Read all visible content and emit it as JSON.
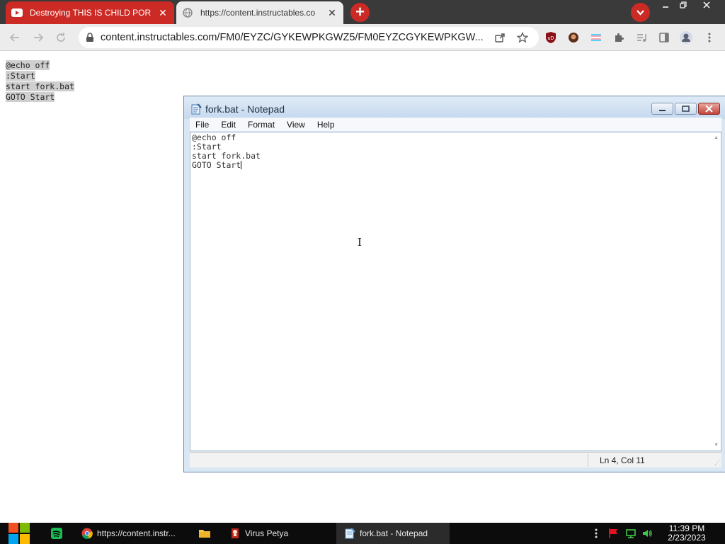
{
  "browser": {
    "tabs": [
      {
        "title": "Destroying THIS IS CHILD POR",
        "favicon": "youtube-icon",
        "active": false
      },
      {
        "title": "https://content.instructables.co",
        "favicon": "globe-icon",
        "active": true
      }
    ],
    "close_glyph": "✕",
    "new_tab_glyph": "+",
    "address_bar": {
      "url": "content.instructables.com/FM0/EYZC/GYKEWPKGWZ5/FM0EYZCGYKEWPKGW..."
    },
    "accent_color": "#cc2a24"
  },
  "page": {
    "code_lines": [
      "@echo off",
      ":Start",
      "start fork.bat",
      "GOTO Start"
    ]
  },
  "notepad": {
    "title": "fork.bat - Notepad",
    "menu": [
      "File",
      "Edit",
      "Format",
      "View",
      "Help"
    ],
    "lines": [
      "@echo off",
      ":Start",
      "start fork.bat",
      "GOTO Start"
    ],
    "status": "Ln 4, Col 11"
  },
  "taskbar": {
    "buttons": [
      {
        "label": "https://content.instr...",
        "icon": "chrome-icon"
      },
      {
        "label": "Virus Petya",
        "icon": "petya-icon"
      },
      {
        "label": "fork.bat - Notepad",
        "icon": "notepad-icon"
      }
    ],
    "time": "11:39 PM",
    "date": "2/23/2023"
  }
}
